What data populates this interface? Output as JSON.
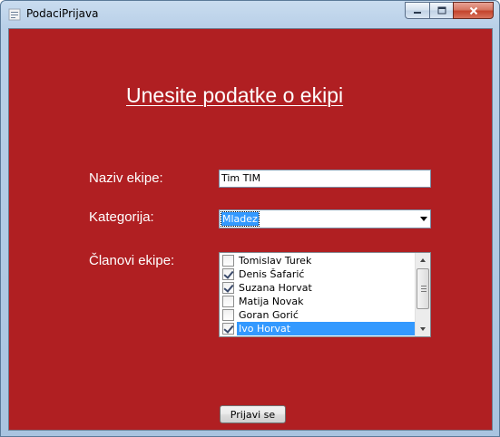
{
  "window": {
    "title": "PodaciPrijava"
  },
  "form": {
    "heading": "Unesite podatke o ekipi",
    "team_name_label": "Naziv ekipe:",
    "team_name_value": "Tim TIM",
    "category_label": "Kategorija:",
    "category_selected": "Mladez",
    "members_label": "Članovi ekipe:",
    "members": [
      {
        "name": "Tomislav Turek",
        "checked": false,
        "selected": false
      },
      {
        "name": "Denis Šafarić",
        "checked": true,
        "selected": false
      },
      {
        "name": "Suzana Horvat",
        "checked": true,
        "selected": false
      },
      {
        "name": "Matija Novak",
        "checked": false,
        "selected": false
      },
      {
        "name": "Goran Gorić",
        "checked": false,
        "selected": false
      },
      {
        "name": "Ivo Horvat",
        "checked": true,
        "selected": true
      }
    ],
    "submit_label": "Prijavi se"
  },
  "colors": {
    "background": "#b01f22",
    "selection": "#3399ff"
  }
}
